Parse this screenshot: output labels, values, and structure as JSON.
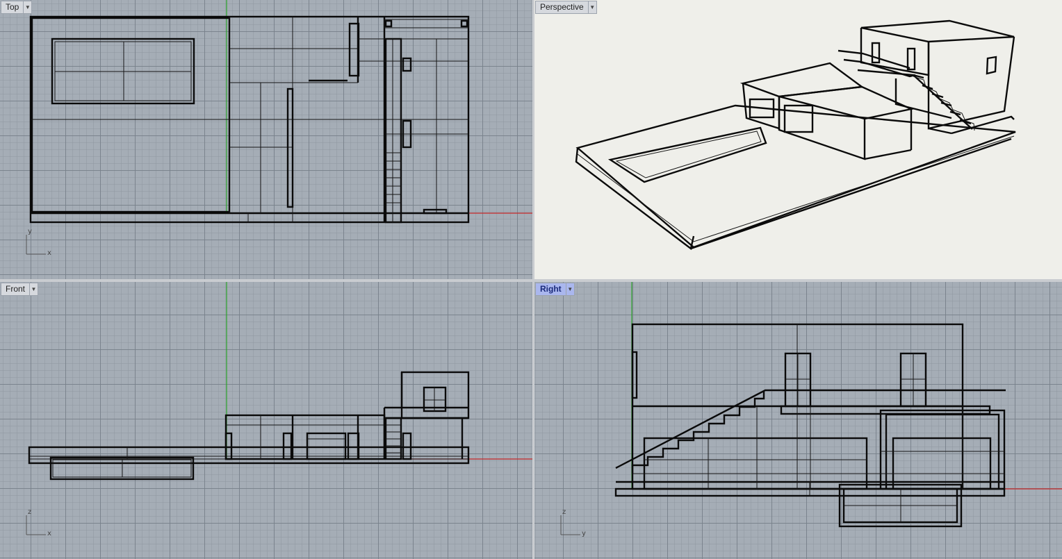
{
  "viewports": {
    "top": {
      "label": "Top"
    },
    "perspective": {
      "label": "Perspective"
    },
    "front": {
      "label": "Front"
    },
    "right": {
      "label": "Right",
      "active": true
    }
  },
  "gizmos": {
    "top": {
      "v": "y",
      "h": "x"
    },
    "front": {
      "v": "z",
      "h": "x"
    },
    "right": {
      "v": "z",
      "h": "y"
    }
  },
  "colors": {
    "grid": "#a5adb6",
    "active_label": "#aab7ee",
    "x_axis": "#c62a2a",
    "y_axis": "#2ba32b"
  },
  "icons": {
    "viewport_menu": "triangle-down-icon"
  }
}
